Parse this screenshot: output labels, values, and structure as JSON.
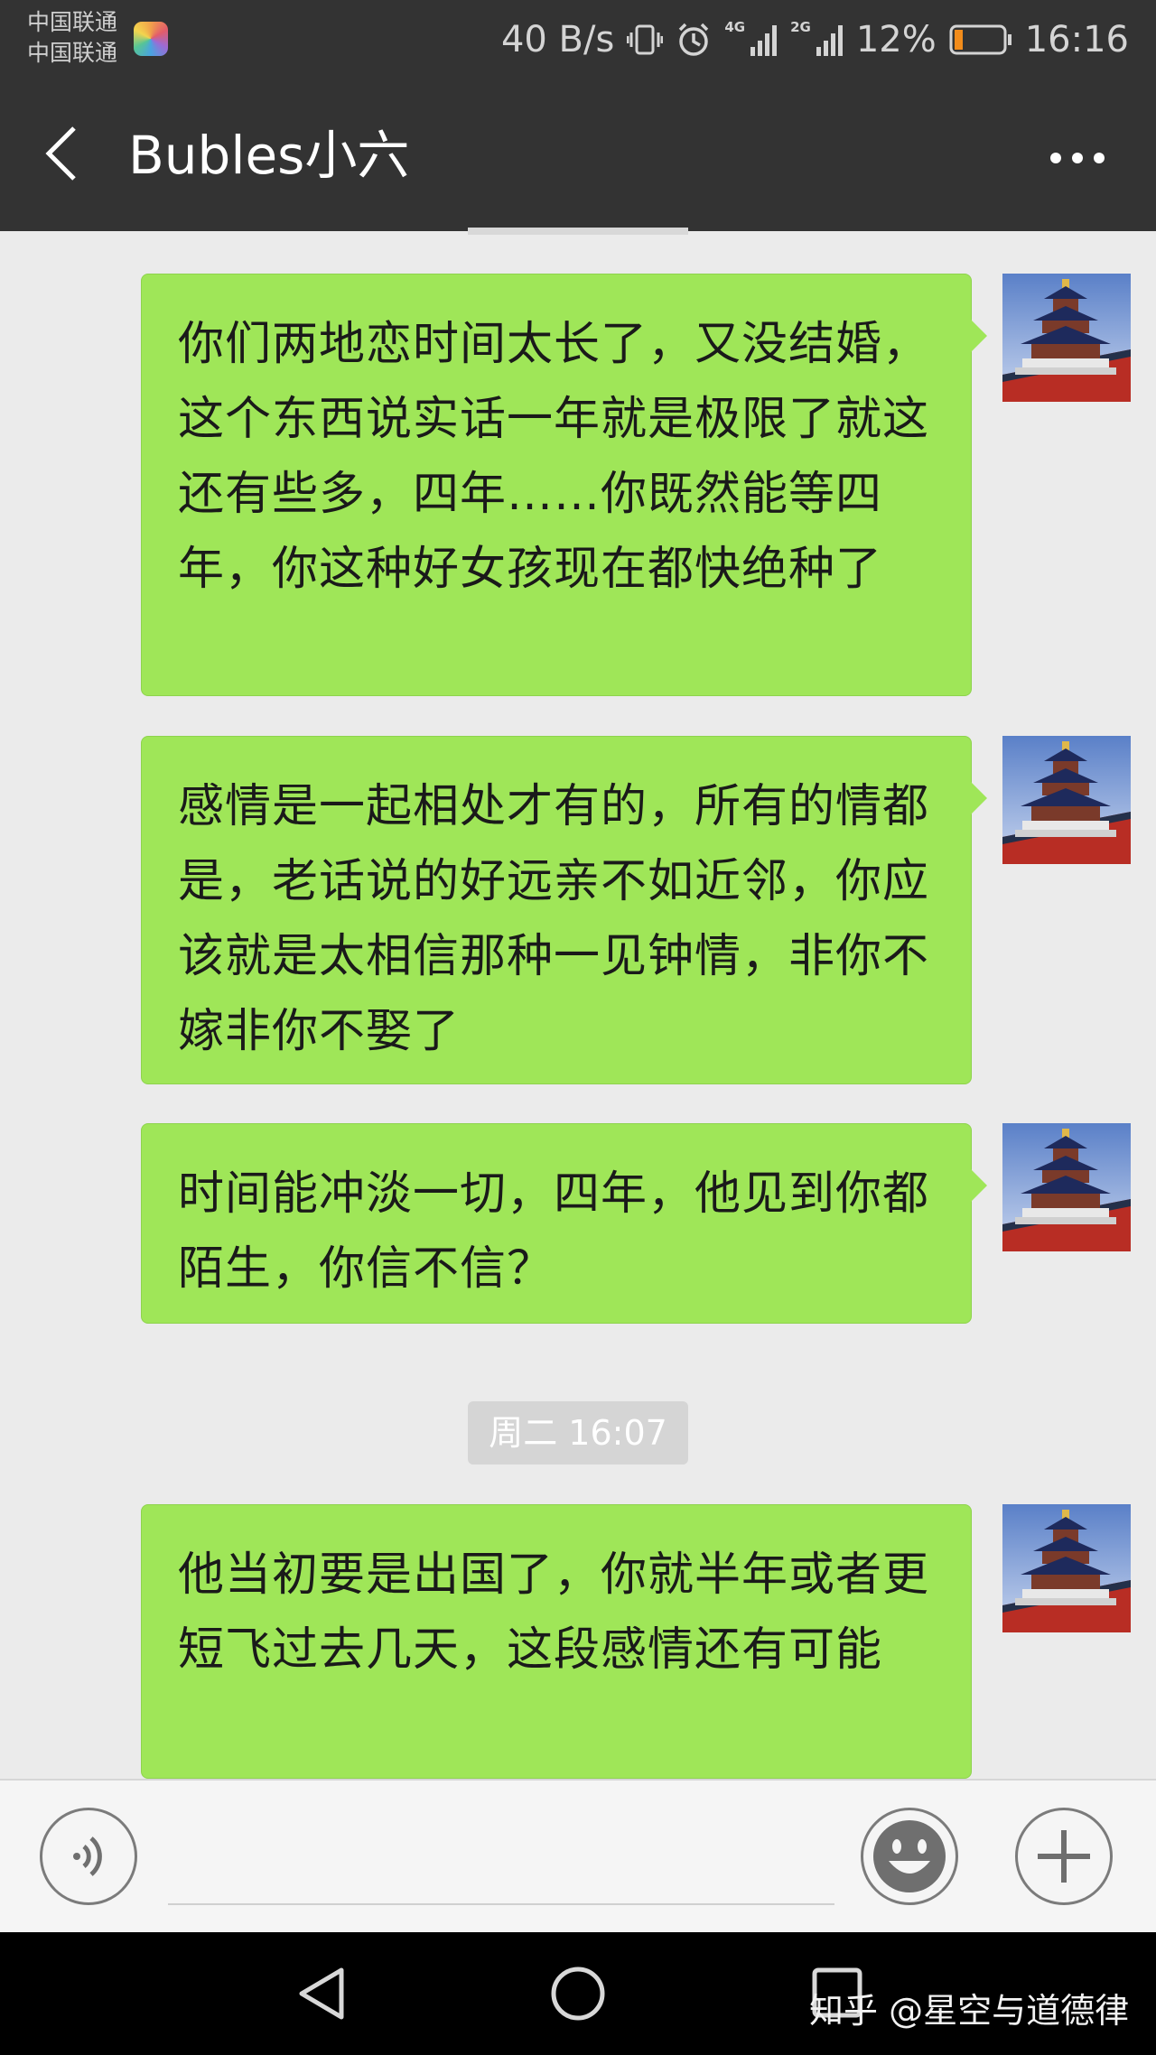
{
  "status_bar": {
    "carrier_1": "中国联通",
    "carrier_2": "中国联通",
    "speed": "40 B/s",
    "net_4g": "4G",
    "net_2g": "2G",
    "battery": "12%",
    "time": "16:16"
  },
  "header": {
    "title": "Bubles小六"
  },
  "messages": [
    {
      "text": "你们两地恋时间太长了，又没结婚，这个东西说实话一年就是极限了就这还有些多，四年……你既然能等四年，你这种好女孩现在都快绝种了"
    },
    {
      "text": "感情是一起相处才有的，所有的情都是，老话说的好远亲不如近邻，你应该就是太相信那种一见钟情，非你不嫁非你不娶了"
    },
    {
      "text": "时间能冲淡一切，四年，他见到你都陌生，你信不信？"
    },
    {
      "text": "他当初要是出国了，你就半年或者更短飞过去几天，这段感情还有可能"
    }
  ],
  "timestamp": "周二 16:07",
  "watermark": "知乎 @星空与道德律",
  "colors": {
    "bubble": "#9fe658",
    "header_bg": "#333333",
    "chat_bg": "#ebebeb"
  }
}
